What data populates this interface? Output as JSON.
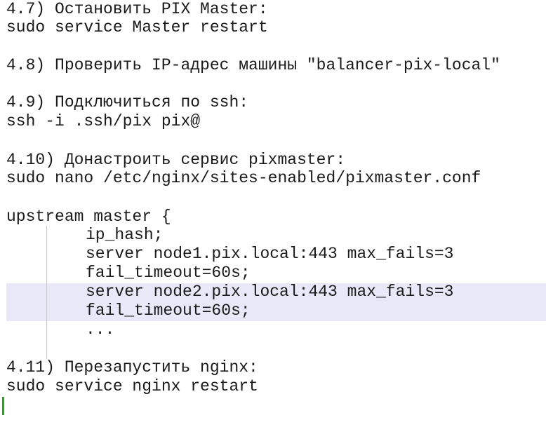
{
  "editor": {
    "lines": [
      "4.7) Остановить PIX Master:",
      "sudo service Master restart",
      "4.8) Проверить IP-адрес машины \"balancer-pix-local\"",
      "4.9) Подключиться по ssh:",
      "ssh -i .ssh/pix pix@",
      "4.10) Донастроить сервис pixmaster:",
      "sudo nano /etc/nginx/sites-enabled/pixmaster.conf",
      "upstream master {",
      "ip_hash;",
      "server node1.pix.local:443 max_fails=3",
      "fail_timeout=60s;",
      "server node2.pix.local:443 max_fails=3",
      "fail_timeout=60s;",
      "...",
      "4.11) Перезапустить nginx:",
      "sudo service nginx restart"
    ],
    "highlight_color": "#e8e8f8",
    "cursor_color": "#1faa1f"
  }
}
